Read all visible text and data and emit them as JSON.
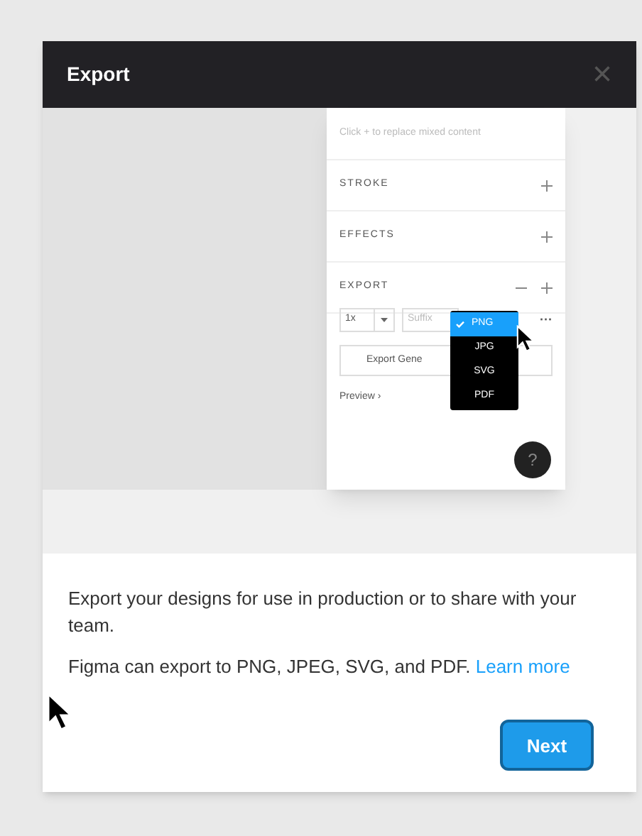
{
  "dialog": {
    "title": "Export",
    "close": "×"
  },
  "illustration": {
    "hint": "Click + to replace mixed content",
    "sections": [
      {
        "label": "STROKE",
        "minus": false
      },
      {
        "label": "EFFECTS",
        "minus": false
      },
      {
        "label": "EXPORT",
        "minus": true
      }
    ],
    "scale": "1x",
    "suffix_placeholder": "Suffix",
    "export_button": "Export Gene",
    "more": "···",
    "preview": "Preview ›",
    "help": "?",
    "formats": [
      {
        "label": "PNG",
        "selected": true
      },
      {
        "label": "JPG",
        "selected": false
      },
      {
        "label": "SVG",
        "selected": false
      },
      {
        "label": "PDF",
        "selected": false
      }
    ]
  },
  "description": "Export your designs for use in production or to share with your team.",
  "formats_text": "Figma can export to PNG, JPEG, SVG, and PDF.",
  "learn_link": "Learn more",
  "next_button": "Next"
}
